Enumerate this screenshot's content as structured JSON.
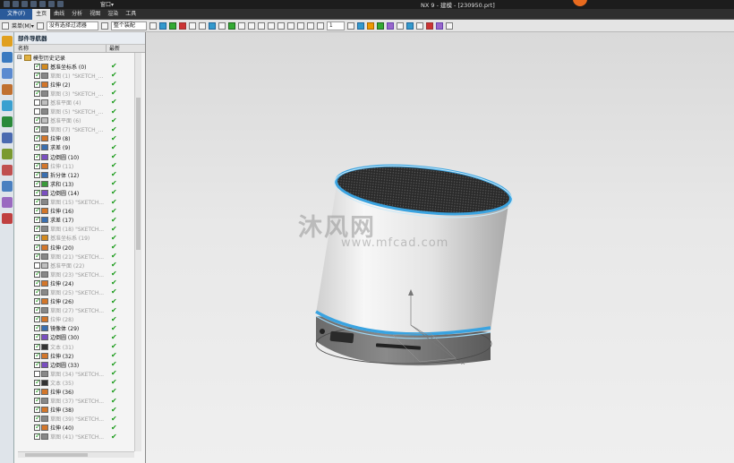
{
  "window": {
    "title": "NX 9 - 建模 - [230950.prt]",
    "window_menu": "窗口▾"
  },
  "menubar": {
    "file": "文件(F)",
    "tabs": [
      {
        "label": "主页",
        "active": true
      },
      {
        "label": "曲线",
        "active": false
      },
      {
        "label": "分析",
        "active": false
      },
      {
        "label": "视图",
        "active": false
      },
      {
        "label": "渲染",
        "active": false
      },
      {
        "label": "工具",
        "active": false
      }
    ]
  },
  "toolbar": {
    "menu_label": "菜单(M)▾",
    "filter_value": "没有选择过滤器",
    "assembly_value": "整个装配",
    "layer_value": "1"
  },
  "navigator": {
    "title": "部件导航器",
    "col_name": "名称",
    "col_latest": "最新",
    "root": "模型历史记录",
    "items": [
      {
        "name": "基准坐标系 (0)",
        "checked": true,
        "dim": false,
        "icon_color": "#d38a1e"
      },
      {
        "name": "草图 (1) \"SKETCH_...",
        "checked": true,
        "dim": true,
        "icon_color": "#888888"
      },
      {
        "name": "拉伸 (2)",
        "checked": true,
        "dim": false,
        "icon_color": "#d3762a"
      },
      {
        "name": "草图 (3) \"SKETCH_...",
        "checked": true,
        "dim": true,
        "icon_color": "#888888"
      },
      {
        "name": "基准平面 (4)",
        "checked": false,
        "dim": true,
        "icon_color": "#bfbfbf"
      },
      {
        "name": "草图 (5) \"SKETCH_...",
        "checked": false,
        "dim": true,
        "icon_color": "#888888"
      },
      {
        "name": "基准平面 (6)",
        "checked": true,
        "dim": true,
        "icon_color": "#bfbfbf"
      },
      {
        "name": "草图 (7) \"SKETCH_...",
        "checked": true,
        "dim": true,
        "icon_color": "#888888"
      },
      {
        "name": "拉伸 (8)",
        "checked": true,
        "dim": false,
        "icon_color": "#d3762a"
      },
      {
        "name": "求差 (9)",
        "checked": true,
        "dim": false,
        "icon_color": "#3a6fb0"
      },
      {
        "name": "边倒圆 (10)",
        "checked": true,
        "dim": false,
        "icon_color": "#7a4fc0"
      },
      {
        "name": "拉伸 (11)",
        "checked": true,
        "dim": true,
        "icon_color": "#d3762a"
      },
      {
        "name": "拆分体 (12)",
        "checked": true,
        "dim": false,
        "icon_color": "#3a6fb0"
      },
      {
        "name": "求和 (13)",
        "checked": true,
        "dim": false,
        "icon_color": "#3a9a3a"
      },
      {
        "name": "边倒圆 (14)",
        "checked": true,
        "dim": false,
        "icon_color": "#7a4fc0"
      },
      {
        "name": "草图 (15) \"SKETCH...",
        "checked": true,
        "dim": true,
        "icon_color": "#888888"
      },
      {
        "name": "拉伸 (16)",
        "checked": true,
        "dim": false,
        "icon_color": "#d3762a"
      },
      {
        "name": "求差 (17)",
        "checked": true,
        "dim": false,
        "icon_color": "#3a6fb0"
      },
      {
        "name": "草图 (18) \"SKETCH...",
        "checked": true,
        "dim": true,
        "icon_color": "#888888"
      },
      {
        "name": "基准坐标系 (19)",
        "checked": true,
        "dim": true,
        "icon_color": "#d38a1e"
      },
      {
        "name": "拉伸 (20)",
        "checked": true,
        "dim": false,
        "icon_color": "#d3762a"
      },
      {
        "name": "草图 (21) \"SKETCH...",
        "checked": true,
        "dim": true,
        "icon_color": "#888888"
      },
      {
        "name": "基准平面 (22)",
        "checked": false,
        "dim": true,
        "icon_color": "#bfbfbf"
      },
      {
        "name": "草图 (23) \"SKETCH...",
        "checked": true,
        "dim": true,
        "icon_color": "#888888"
      },
      {
        "name": "拉伸 (24)",
        "checked": true,
        "dim": false,
        "icon_color": "#d3762a"
      },
      {
        "name": "草图 (25) \"SKETCH...",
        "checked": true,
        "dim": true,
        "icon_color": "#888888"
      },
      {
        "name": "拉伸 (26)",
        "checked": true,
        "dim": false,
        "icon_color": "#d3762a"
      },
      {
        "name": "草图 (27) \"SKETCH...",
        "checked": true,
        "dim": true,
        "icon_color": "#888888"
      },
      {
        "name": "拉伸 (28)",
        "checked": true,
        "dim": true,
        "icon_color": "#d3762a"
      },
      {
        "name": "镜像体 (29)",
        "checked": true,
        "dim": false,
        "icon_color": "#3a6fb0"
      },
      {
        "name": "边倒圆 (30)",
        "checked": true,
        "dim": false,
        "icon_color": "#7a4fc0"
      },
      {
        "name": "文本 (31)",
        "checked": true,
        "dim": true,
        "icon_color": "#333333"
      },
      {
        "name": "拉伸 (32)",
        "checked": true,
        "dim": false,
        "icon_color": "#d3762a"
      },
      {
        "name": "边倒圆 (33)",
        "checked": true,
        "dim": false,
        "icon_color": "#7a4fc0"
      },
      {
        "name": "草图 (34) \"SKETCH...",
        "checked": false,
        "dim": true,
        "icon_color": "#888888"
      },
      {
        "name": "文本 (35)",
        "checked": true,
        "dim": true,
        "icon_color": "#333333"
      },
      {
        "name": "拉伸 (36)",
        "checked": true,
        "dim": false,
        "icon_color": "#d3762a"
      },
      {
        "name": "草图 (37) \"SKETCH...",
        "checked": true,
        "dim": true,
        "icon_color": "#888888"
      },
      {
        "name": "拉伸 (38)",
        "checked": true,
        "dim": false,
        "icon_color": "#d3762a"
      },
      {
        "name": "草图 (39) \"SKETCH...",
        "checked": true,
        "dim": true,
        "icon_color": "#888888"
      },
      {
        "name": "拉伸 (40)",
        "checked": true,
        "dim": false,
        "icon_color": "#d3762a"
      },
      {
        "name": "草图 (41) \"SKETCH...",
        "checked": true,
        "dim": true,
        "icon_color": "#888888"
      }
    ]
  },
  "viewport": {
    "watermark_text": "沐风网",
    "watermark_url": "www.mfcad.com",
    "axis_x": "X",
    "axis_y": "Y",
    "axis_z": "Z",
    "ring_color": "#3aa3e0",
    "body_color": "#f2f2f2",
    "base_color": "#7a7a7a"
  },
  "resourcebar": {
    "icons": [
      "assembly-navigator-icon",
      "constraint-navigator-icon",
      "part-navigator-icon",
      "reuse-library-icon",
      "hd3d-tools-icon",
      "web-browser-icon",
      "history-icon",
      "system-materials-icon",
      "process-studio-icon",
      "manufacturing-wizard-icon",
      "roles-icon",
      "system-scenes-icon"
    ]
  }
}
